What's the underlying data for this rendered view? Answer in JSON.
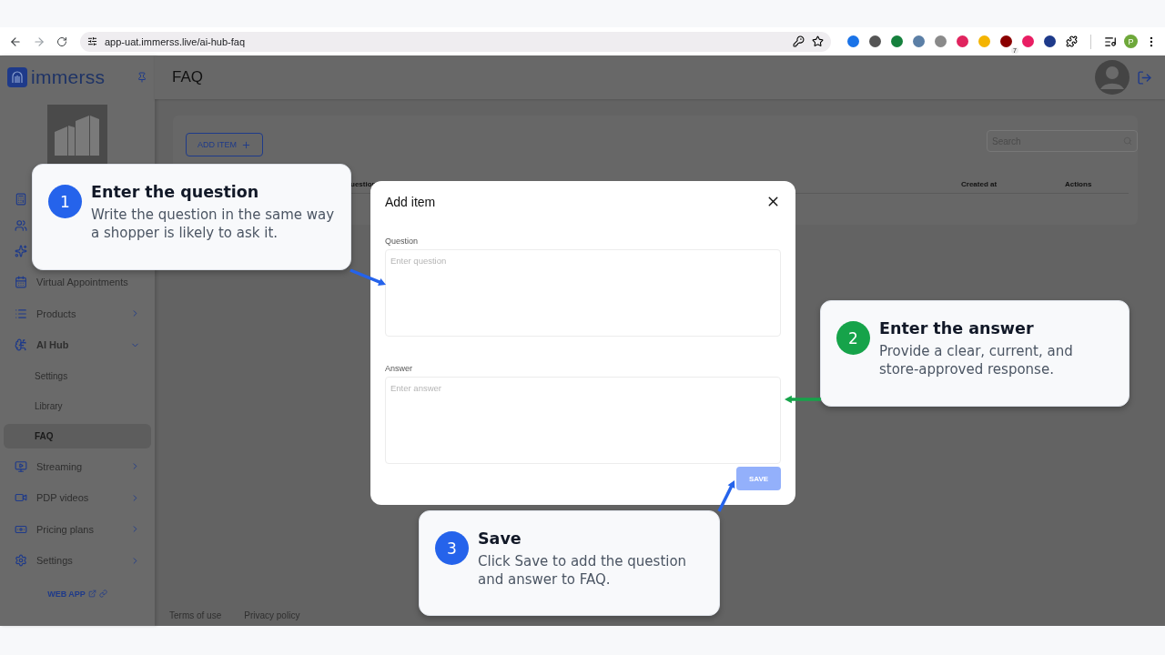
{
  "browser": {
    "url": "app-uat.immerss.live/ai-hub-faq",
    "extension_badge": "7",
    "profile_initial": "P"
  },
  "sidebar": {
    "brand": "immerss",
    "items": [
      {
        "label": "Virtual Appointments"
      },
      {
        "label": "Products",
        "expanded": false
      },
      {
        "label": "AI Hub",
        "expanded": true,
        "children": [
          {
            "label": "Settings",
            "selected": false
          },
          {
            "label": "Library",
            "selected": false
          },
          {
            "label": "FAQ",
            "selected": true
          }
        ]
      },
      {
        "label": "Streaming",
        "expanded": false
      },
      {
        "label": "PDP videos",
        "expanded": false
      },
      {
        "label": "Pricing plans",
        "expanded": false
      },
      {
        "label": "Settings",
        "expanded": false
      }
    ],
    "web_app_link": "WEB APP"
  },
  "header": {
    "title": "FAQ"
  },
  "content": {
    "add_button": "ADD ITEM",
    "search": {
      "placeholder": "Search"
    },
    "table": {
      "columns": [
        "uestion",
        "Created at",
        "Actions"
      ]
    }
  },
  "footer": {
    "links": [
      "Terms of use",
      "Privacy policy"
    ]
  },
  "dialog": {
    "title": "Add item",
    "fields": [
      {
        "label": "Question",
        "placeholder": "Enter question"
      },
      {
        "label": "Answer",
        "placeholder": "Enter answer"
      }
    ],
    "save": {
      "label": "SAVE",
      "disabled": true
    }
  },
  "callouts": [
    {
      "number": "1",
      "title": "Enter the question",
      "text": "Write the question in the same way a shopper is likely to ask it.",
      "color": "#2563eb"
    },
    {
      "number": "2",
      "title": "Enter the answer",
      "text": "Provide a clear, current, and store-approved response.",
      "color": "#16a34a"
    },
    {
      "number": "3",
      "title": "Save",
      "text": "Click Save to add the question and answer to FAQ.",
      "color": "#2563eb"
    }
  ]
}
